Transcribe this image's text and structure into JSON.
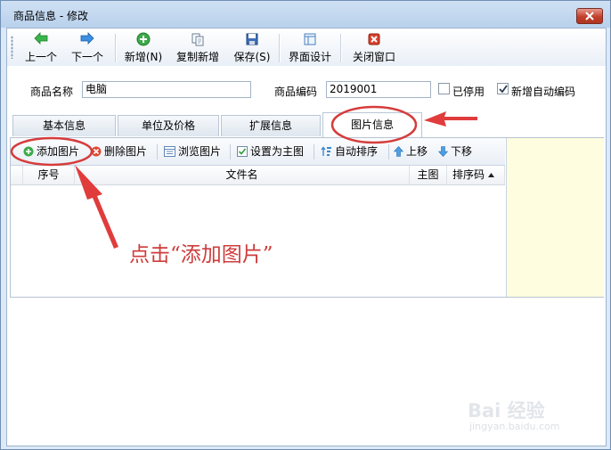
{
  "window": {
    "title": "商品信息 - 修改"
  },
  "toolbar": {
    "prev": "上一个",
    "next": "下一个",
    "add": "新增(N)",
    "copy_add": "复制新增",
    "save": "保存(S)",
    "ui_design": "界面设计",
    "close": "关闭窗口"
  },
  "fields": {
    "name_label": "商品名称",
    "name_value": "电脑",
    "code_label": "商品编码",
    "code_value": "2019001",
    "disabled_label": "已停用",
    "disabled_checked": false,
    "auto_code_label": "新增自动编码",
    "auto_code_checked": true
  },
  "tabs": [
    {
      "label": "基本信息",
      "active": false
    },
    {
      "label": "单位及价格",
      "active": false
    },
    {
      "label": "扩展信息",
      "active": false
    },
    {
      "label": "图片信息",
      "active": true
    }
  ],
  "image_toolbar": {
    "add": "添加图片",
    "delete": "删除图片",
    "browse": "浏览图片",
    "set_main": "设置为主图",
    "auto_sort": "自动排序",
    "move_up": "上移",
    "move_down": "下移"
  },
  "grid": {
    "columns": [
      "序号",
      "文件名",
      "主图",
      "排序码"
    ],
    "rows": []
  },
  "annotation": {
    "text": "点击“添加图片”"
  },
  "watermark": {
    "logo": "Bai 经验",
    "url": "jingyan.baidu.com"
  },
  "colors": {
    "annotation_red": "#cf3c3c",
    "side_panel": "#fffddf",
    "title_bar": "#c3d7ef"
  }
}
